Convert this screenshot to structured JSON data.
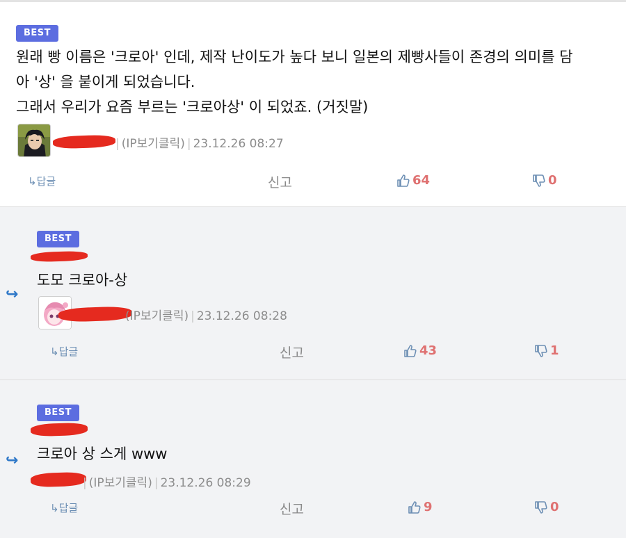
{
  "colors": {
    "best_badge": "#5c6de0",
    "reply_arrow": "#2f78c8",
    "vote_count": "#df7171",
    "redaction": "#e52a1f"
  },
  "comments": [
    {
      "badge": "BEST",
      "lines": [
        "원래 빵 이름은 '크로아' 인데, 제작 난이도가 높다 보니 일본의 제빵사들이 존경의 의미를 담",
        "아 '상' 을 붙이게 되었습니다.",
        "그래서 우리가 요즘 부르는 '크로아상' 이 되었죠. (거짓말)"
      ],
      "ip_label": "(IP보기클릭)",
      "timestamp": "23.12.26 08:27",
      "reply_label": "답글",
      "report_label": "신고",
      "upvotes": "64",
      "downvotes": "0",
      "avatar_icon": "dark-haired-character-avatar"
    },
    {
      "badge": "BEST",
      "lines": [
        "도모 크로아-상"
      ],
      "ip_label": "(IP보기클릭)",
      "timestamp": "23.12.26 08:28",
      "reply_label": "답글",
      "report_label": "신고",
      "upvotes": "43",
      "downvotes": "1",
      "avatar_icon": "pink-haired-character-avatar"
    },
    {
      "badge": "BEST",
      "lines": [
        "크로아 상 스게 www"
      ],
      "ip_label": "(IP보기클릭)",
      "timestamp": "23.12.26 08:29",
      "reply_label": "답글",
      "report_label": "신고",
      "upvotes": "9",
      "downvotes": "0"
    }
  ]
}
